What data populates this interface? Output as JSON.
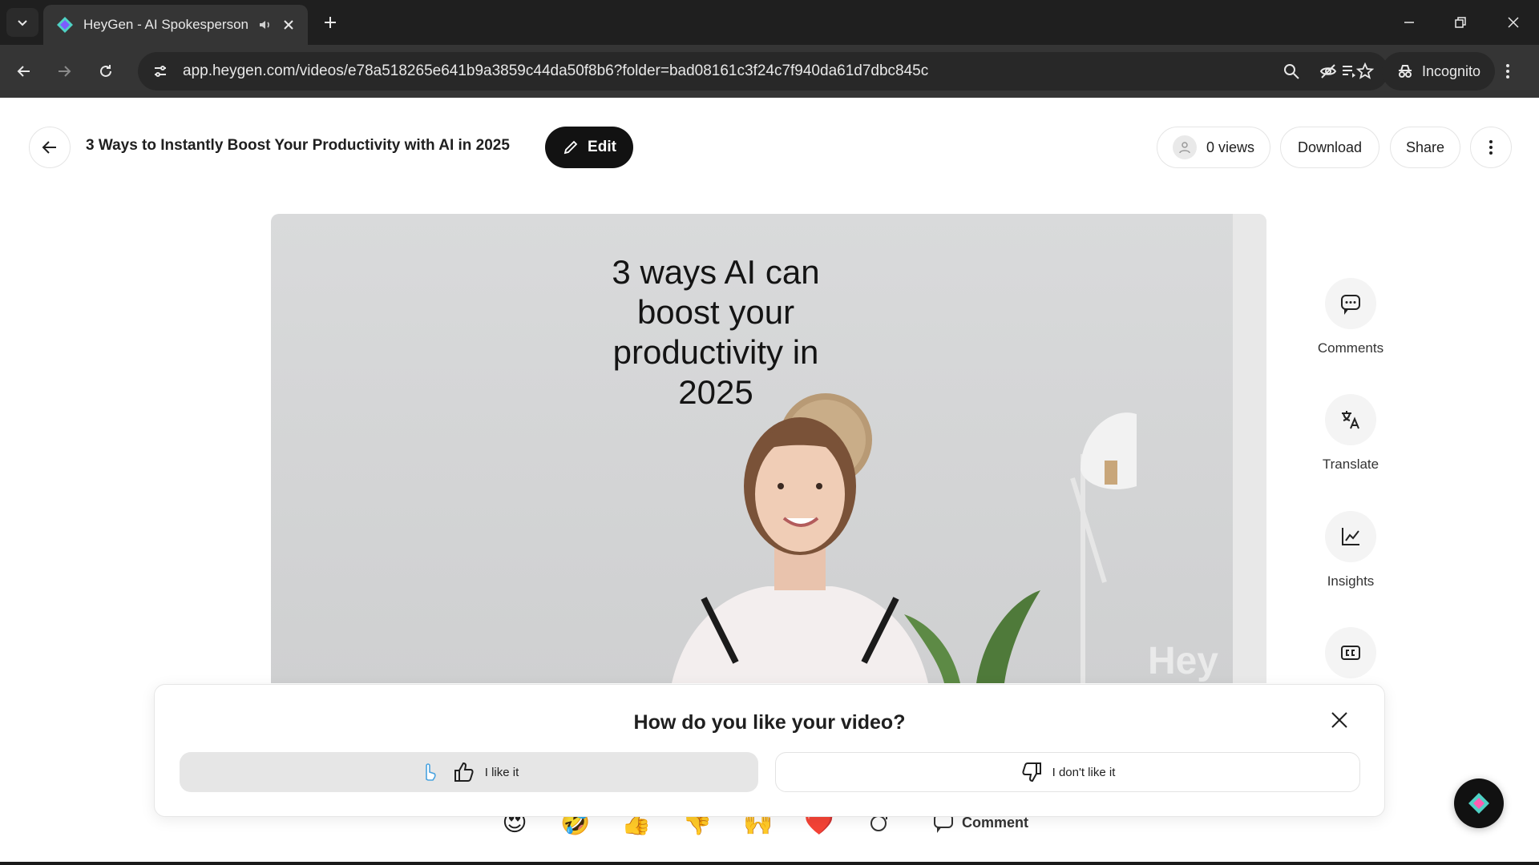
{
  "browser": {
    "tab_title": "HeyGen - AI Spokesperson",
    "url": "app.heygen.com/videos/e78a518265e641b9a3859c44da50f8b6?folder=bad08161c3f24c7f940da61d7dbc845c",
    "incognito_label": "Incognito"
  },
  "header": {
    "title": "3 Ways to Instantly Boost Your Productivity with AI in 2025",
    "edit_label": "Edit",
    "views_label": "0 views",
    "download_label": "Download",
    "share_label": "Share"
  },
  "video": {
    "caption": "3 ways AI can boost your productivity in 2025",
    "watermark": "Hey"
  },
  "side_actions": {
    "comments": "Comments",
    "translate": "Translate",
    "insights": "Insights"
  },
  "feedback": {
    "title": "How do you like your video?",
    "like_label": "I like it",
    "dislike_label": "I don't like it"
  },
  "reactions": {
    "items": [
      "😍",
      "🤣",
      "👍",
      "👎",
      "🙌",
      "❤️"
    ],
    "comment_label": "Comment"
  },
  "colors": {
    "chrome_dark": "#1f1f1f",
    "chrome_mid": "#353535",
    "edit_button": "#121212",
    "like_button_bg": "#e6e6e6"
  }
}
